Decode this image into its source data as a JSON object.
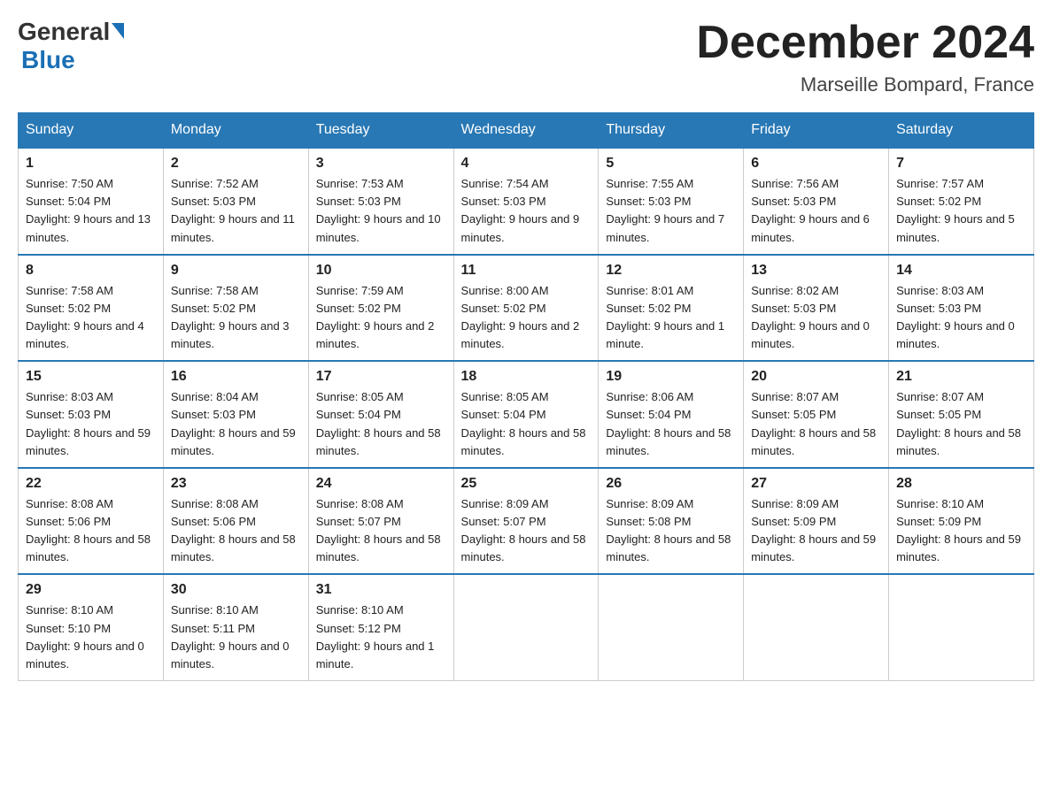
{
  "logo": {
    "general": "General",
    "blue": "Blue"
  },
  "title": "December 2024",
  "location": "Marseille Bompard, France",
  "headers": [
    "Sunday",
    "Monday",
    "Tuesday",
    "Wednesday",
    "Thursday",
    "Friday",
    "Saturday"
  ],
  "weeks": [
    [
      {
        "day": "1",
        "sunrise": "7:50 AM",
        "sunset": "5:04 PM",
        "daylight": "9 hours and 13 minutes."
      },
      {
        "day": "2",
        "sunrise": "7:52 AM",
        "sunset": "5:03 PM",
        "daylight": "9 hours and 11 minutes."
      },
      {
        "day": "3",
        "sunrise": "7:53 AM",
        "sunset": "5:03 PM",
        "daylight": "9 hours and 10 minutes."
      },
      {
        "day": "4",
        "sunrise": "7:54 AM",
        "sunset": "5:03 PM",
        "daylight": "9 hours and 9 minutes."
      },
      {
        "day": "5",
        "sunrise": "7:55 AM",
        "sunset": "5:03 PM",
        "daylight": "9 hours and 7 minutes."
      },
      {
        "day": "6",
        "sunrise": "7:56 AM",
        "sunset": "5:03 PM",
        "daylight": "9 hours and 6 minutes."
      },
      {
        "day": "7",
        "sunrise": "7:57 AM",
        "sunset": "5:02 PM",
        "daylight": "9 hours and 5 minutes."
      }
    ],
    [
      {
        "day": "8",
        "sunrise": "7:58 AM",
        "sunset": "5:02 PM",
        "daylight": "9 hours and 4 minutes."
      },
      {
        "day": "9",
        "sunrise": "7:58 AM",
        "sunset": "5:02 PM",
        "daylight": "9 hours and 3 minutes."
      },
      {
        "day": "10",
        "sunrise": "7:59 AM",
        "sunset": "5:02 PM",
        "daylight": "9 hours and 2 minutes."
      },
      {
        "day": "11",
        "sunrise": "8:00 AM",
        "sunset": "5:02 PM",
        "daylight": "9 hours and 2 minutes."
      },
      {
        "day": "12",
        "sunrise": "8:01 AM",
        "sunset": "5:02 PM",
        "daylight": "9 hours and 1 minute."
      },
      {
        "day": "13",
        "sunrise": "8:02 AM",
        "sunset": "5:03 PM",
        "daylight": "9 hours and 0 minutes."
      },
      {
        "day": "14",
        "sunrise": "8:03 AM",
        "sunset": "5:03 PM",
        "daylight": "9 hours and 0 minutes."
      }
    ],
    [
      {
        "day": "15",
        "sunrise": "8:03 AM",
        "sunset": "5:03 PM",
        "daylight": "8 hours and 59 minutes."
      },
      {
        "day": "16",
        "sunrise": "8:04 AM",
        "sunset": "5:03 PM",
        "daylight": "8 hours and 59 minutes."
      },
      {
        "day": "17",
        "sunrise": "8:05 AM",
        "sunset": "5:04 PM",
        "daylight": "8 hours and 58 minutes."
      },
      {
        "day": "18",
        "sunrise": "8:05 AM",
        "sunset": "5:04 PM",
        "daylight": "8 hours and 58 minutes."
      },
      {
        "day": "19",
        "sunrise": "8:06 AM",
        "sunset": "5:04 PM",
        "daylight": "8 hours and 58 minutes."
      },
      {
        "day": "20",
        "sunrise": "8:07 AM",
        "sunset": "5:05 PM",
        "daylight": "8 hours and 58 minutes."
      },
      {
        "day": "21",
        "sunrise": "8:07 AM",
        "sunset": "5:05 PM",
        "daylight": "8 hours and 58 minutes."
      }
    ],
    [
      {
        "day": "22",
        "sunrise": "8:08 AM",
        "sunset": "5:06 PM",
        "daylight": "8 hours and 58 minutes."
      },
      {
        "day": "23",
        "sunrise": "8:08 AM",
        "sunset": "5:06 PM",
        "daylight": "8 hours and 58 minutes."
      },
      {
        "day": "24",
        "sunrise": "8:08 AM",
        "sunset": "5:07 PM",
        "daylight": "8 hours and 58 minutes."
      },
      {
        "day": "25",
        "sunrise": "8:09 AM",
        "sunset": "5:07 PM",
        "daylight": "8 hours and 58 minutes."
      },
      {
        "day": "26",
        "sunrise": "8:09 AM",
        "sunset": "5:08 PM",
        "daylight": "8 hours and 58 minutes."
      },
      {
        "day": "27",
        "sunrise": "8:09 AM",
        "sunset": "5:09 PM",
        "daylight": "8 hours and 59 minutes."
      },
      {
        "day": "28",
        "sunrise": "8:10 AM",
        "sunset": "5:09 PM",
        "daylight": "8 hours and 59 minutes."
      }
    ],
    [
      {
        "day": "29",
        "sunrise": "8:10 AM",
        "sunset": "5:10 PM",
        "daylight": "9 hours and 0 minutes."
      },
      {
        "day": "30",
        "sunrise": "8:10 AM",
        "sunset": "5:11 PM",
        "daylight": "9 hours and 0 minutes."
      },
      {
        "day": "31",
        "sunrise": "8:10 AM",
        "sunset": "5:12 PM",
        "daylight": "9 hours and 1 minute."
      },
      null,
      null,
      null,
      null
    ]
  ],
  "labels": {
    "sunrise": "Sunrise:",
    "sunset": "Sunset:",
    "daylight": "Daylight:"
  }
}
